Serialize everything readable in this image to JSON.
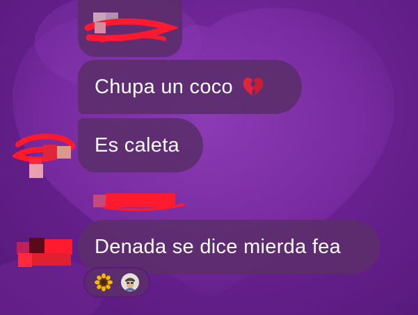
{
  "chat": {
    "messages": [
      {
        "text": "Chupa un coco",
        "emoji": "broken-heart"
      },
      {
        "text": "Es caleta"
      },
      {
        "text": "Denada se dice mierda fea"
      }
    ],
    "reactions": [
      {
        "icon": "sunflower"
      },
      {
        "icon": "avatar-sticker"
      }
    ]
  },
  "colors": {
    "background": "#6a2190",
    "bubble": "#5c2e6c",
    "redaction": "#ff1a2e",
    "text": "#ffffff"
  }
}
